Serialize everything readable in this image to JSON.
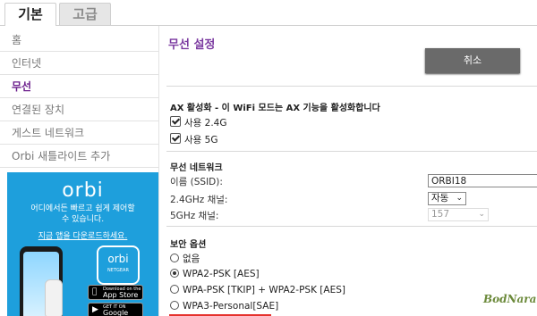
{
  "tabs": {
    "basic": "기본",
    "advanced": "고급"
  },
  "sidebar": {
    "items": [
      {
        "label": "홈"
      },
      {
        "label": "인터넷"
      },
      {
        "label": "무선"
      },
      {
        "label": "연결된 장치"
      },
      {
        "label": "게스트 네트워크"
      },
      {
        "label": "Orbi 새틀라이트 추가"
      }
    ],
    "ad": {
      "logo": "orbi",
      "line1": "어디에서든 빠르고 쉽게 제어할",
      "line2": "수 있습니다.",
      "link": "지금 앱을 다운로드하세요.",
      "app_icon_text": "orbi",
      "app_icon_sub": "NETGEAR",
      "appstore_small": "Download on the",
      "appstore_label": "App Store",
      "googleplay_small": "GET IT ON",
      "googleplay_label": "Google Play"
    }
  },
  "main": {
    "title": "무선 설정",
    "cancel_label": "취소",
    "ax": {
      "heading": "AX 활성화 - 이 WiFi 모드는 AX 기능을 활성화합니다",
      "use24": "사용 2.4G",
      "use5": "사용 5G"
    },
    "network": {
      "heading": "무선 네트워크",
      "ssid_label": "이름 (SSID):",
      "ssid_value": "ORBI18",
      "ch24_label": "2.4GHz 채널:",
      "ch24_value": "자동",
      "ch5_label": "5GHz 채널:",
      "ch5_value": "157"
    },
    "security": {
      "heading": "보안 옵션",
      "opt_none": "없음",
      "opt_wpa2": "WPA2-PSK [AES]",
      "opt_mixed": "WPA-PSK [TKIP] + WPA2-PSK [AES]",
      "opt_wpa3": "WPA3-Personal[SAE]"
    }
  },
  "watermark": "BodNara",
  "colors": {
    "accent": "#7b3aa0",
    "ad_bg": "#1e9fdc",
    "highlight": "#e5322d"
  }
}
